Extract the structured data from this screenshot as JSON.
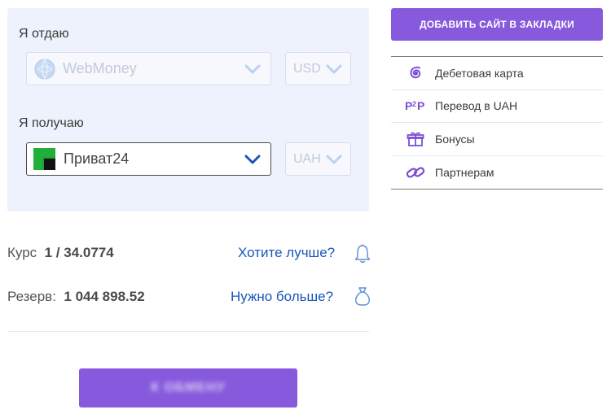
{
  "exchange_form": {
    "give_label": "Я отдаю",
    "give_system": "WebMoney",
    "give_currency": "USD",
    "get_label": "Я получаю",
    "get_system": "Приват24",
    "get_currency": "UAH"
  },
  "rate": {
    "label": "Курс",
    "value": "1 / 34.0774",
    "link": "Хотите лучше?"
  },
  "reserve": {
    "label": "Резерв:",
    "value": "1 044 898.52",
    "link": "Нужно больше?"
  },
  "exchange_button": {
    "label": "К ОБМЕНУ"
  },
  "sidebar": {
    "bookmark_button": "ДОБАВИТЬ САЙТ В ЗАКЛАДКИ",
    "items": [
      {
        "label": "Дебетовая карта",
        "icon": "spiral-icon"
      },
      {
        "label": "Перевод в UAH",
        "icon": "p2p-icon"
      },
      {
        "label": "Бонусы",
        "icon": "gift-icon"
      },
      {
        "label": "Партнерам",
        "icon": "link-icon"
      }
    ]
  },
  "colors": {
    "accent": "#8759dd",
    "link": "#1a56b8",
    "panel": "#edf2fd",
    "privat_green": "#1aa034"
  }
}
